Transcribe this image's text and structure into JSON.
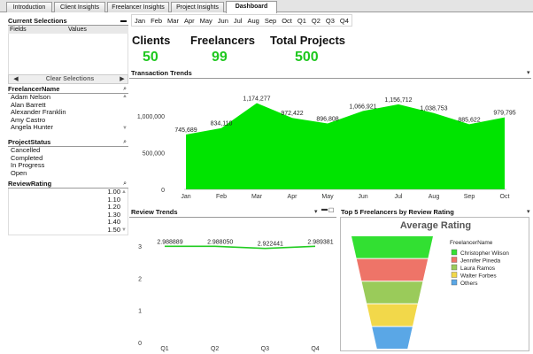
{
  "tabs": [
    "Introduction",
    "Client Insights",
    "Freelancer Insights",
    "Project Insights",
    "Dashboard"
  ],
  "current_selections": {
    "title": "Current Selections",
    "col_fields": "Fields",
    "col_values": "Values",
    "clear_label": "Clear Selections"
  },
  "freelancer_list": {
    "title": "FreelancerName",
    "items": [
      "Adam Nelson",
      "Alan Barrett",
      "Alexander Franklin",
      "Amy Castro",
      "Angela Hunter"
    ]
  },
  "status_list": {
    "title": "ProjectStatus",
    "items": [
      "Cancelled",
      "Completed",
      "In Progress",
      "Open"
    ]
  },
  "rating_list": {
    "title": "ReviewRating",
    "items": [
      "1.00",
      "1.10",
      "1.20",
      "1.30",
      "1.40",
      "1.50"
    ]
  },
  "months": [
    "Jan",
    "Feb",
    "Mar",
    "Apr",
    "May",
    "Jun",
    "Jul",
    "Aug",
    "Sep",
    "Oct",
    "Q1",
    "Q2",
    "Q3",
    "Q4"
  ],
  "kpis": {
    "clients_label": "Clients",
    "clients_value": "50",
    "freelancers_label": "Freelancers",
    "freelancers_value": "99",
    "projects_label": "Total Projects",
    "projects_value": "500"
  },
  "charts": {
    "transaction_title": "Transaction Trends",
    "review_title": "Review Trends",
    "top5_title": "Top 5 Freelancers by Review Rating"
  },
  "chart_data": [
    {
      "type": "area",
      "title": "Transaction Trends",
      "categories": [
        "Jan",
        "Feb",
        "Mar",
        "Apr",
        "May",
        "Jun",
        "Jul",
        "Aug",
        "Sep",
        "Oct"
      ],
      "values": [
        745689,
        834110,
        1174277,
        972422,
        896808,
        1066921,
        1156712,
        1038753,
        885622,
        979795
      ],
      "data_labels": [
        "745,689",
        "834,110",
        "1,174,277",
        "972,422",
        "896,808",
        "1,066,921",
        "1,156,712",
        "1,038,753",
        "885,622",
        "979,795"
      ],
      "y_ticks": [
        "0",
        "500,000",
        "1,000,000"
      ],
      "ylim": [
        0,
        1300000
      ],
      "color": "#00e400"
    },
    {
      "type": "line",
      "title": "Review Trends",
      "categories": [
        "Q1",
        "Q2",
        "Q3",
        "Q4"
      ],
      "values": [
        2.988889,
        2.98805,
        2.922441,
        2.989381
      ],
      "data_labels": [
        "2.988889",
        "2.988050",
        "2.922441",
        "2.989381"
      ],
      "y_ticks": [
        "0",
        "1",
        "2",
        "3"
      ],
      "ylim": [
        0,
        3.3
      ],
      "color": "#22cc22"
    },
    {
      "type": "funnel",
      "title": "Average Rating",
      "legend_title": "FreelancerName",
      "series": [
        {
          "name": "Christopher Wilson",
          "color": "#32e032"
        },
        {
          "name": "Jennifer Pineda",
          "color": "#ee7468"
        },
        {
          "name": "Laura Ramos",
          "color": "#9acb5a"
        },
        {
          "name": "Walter Forbes",
          "color": "#f2d84a"
        },
        {
          "name": "Others",
          "color": "#5aa7e6"
        }
      ]
    }
  ]
}
